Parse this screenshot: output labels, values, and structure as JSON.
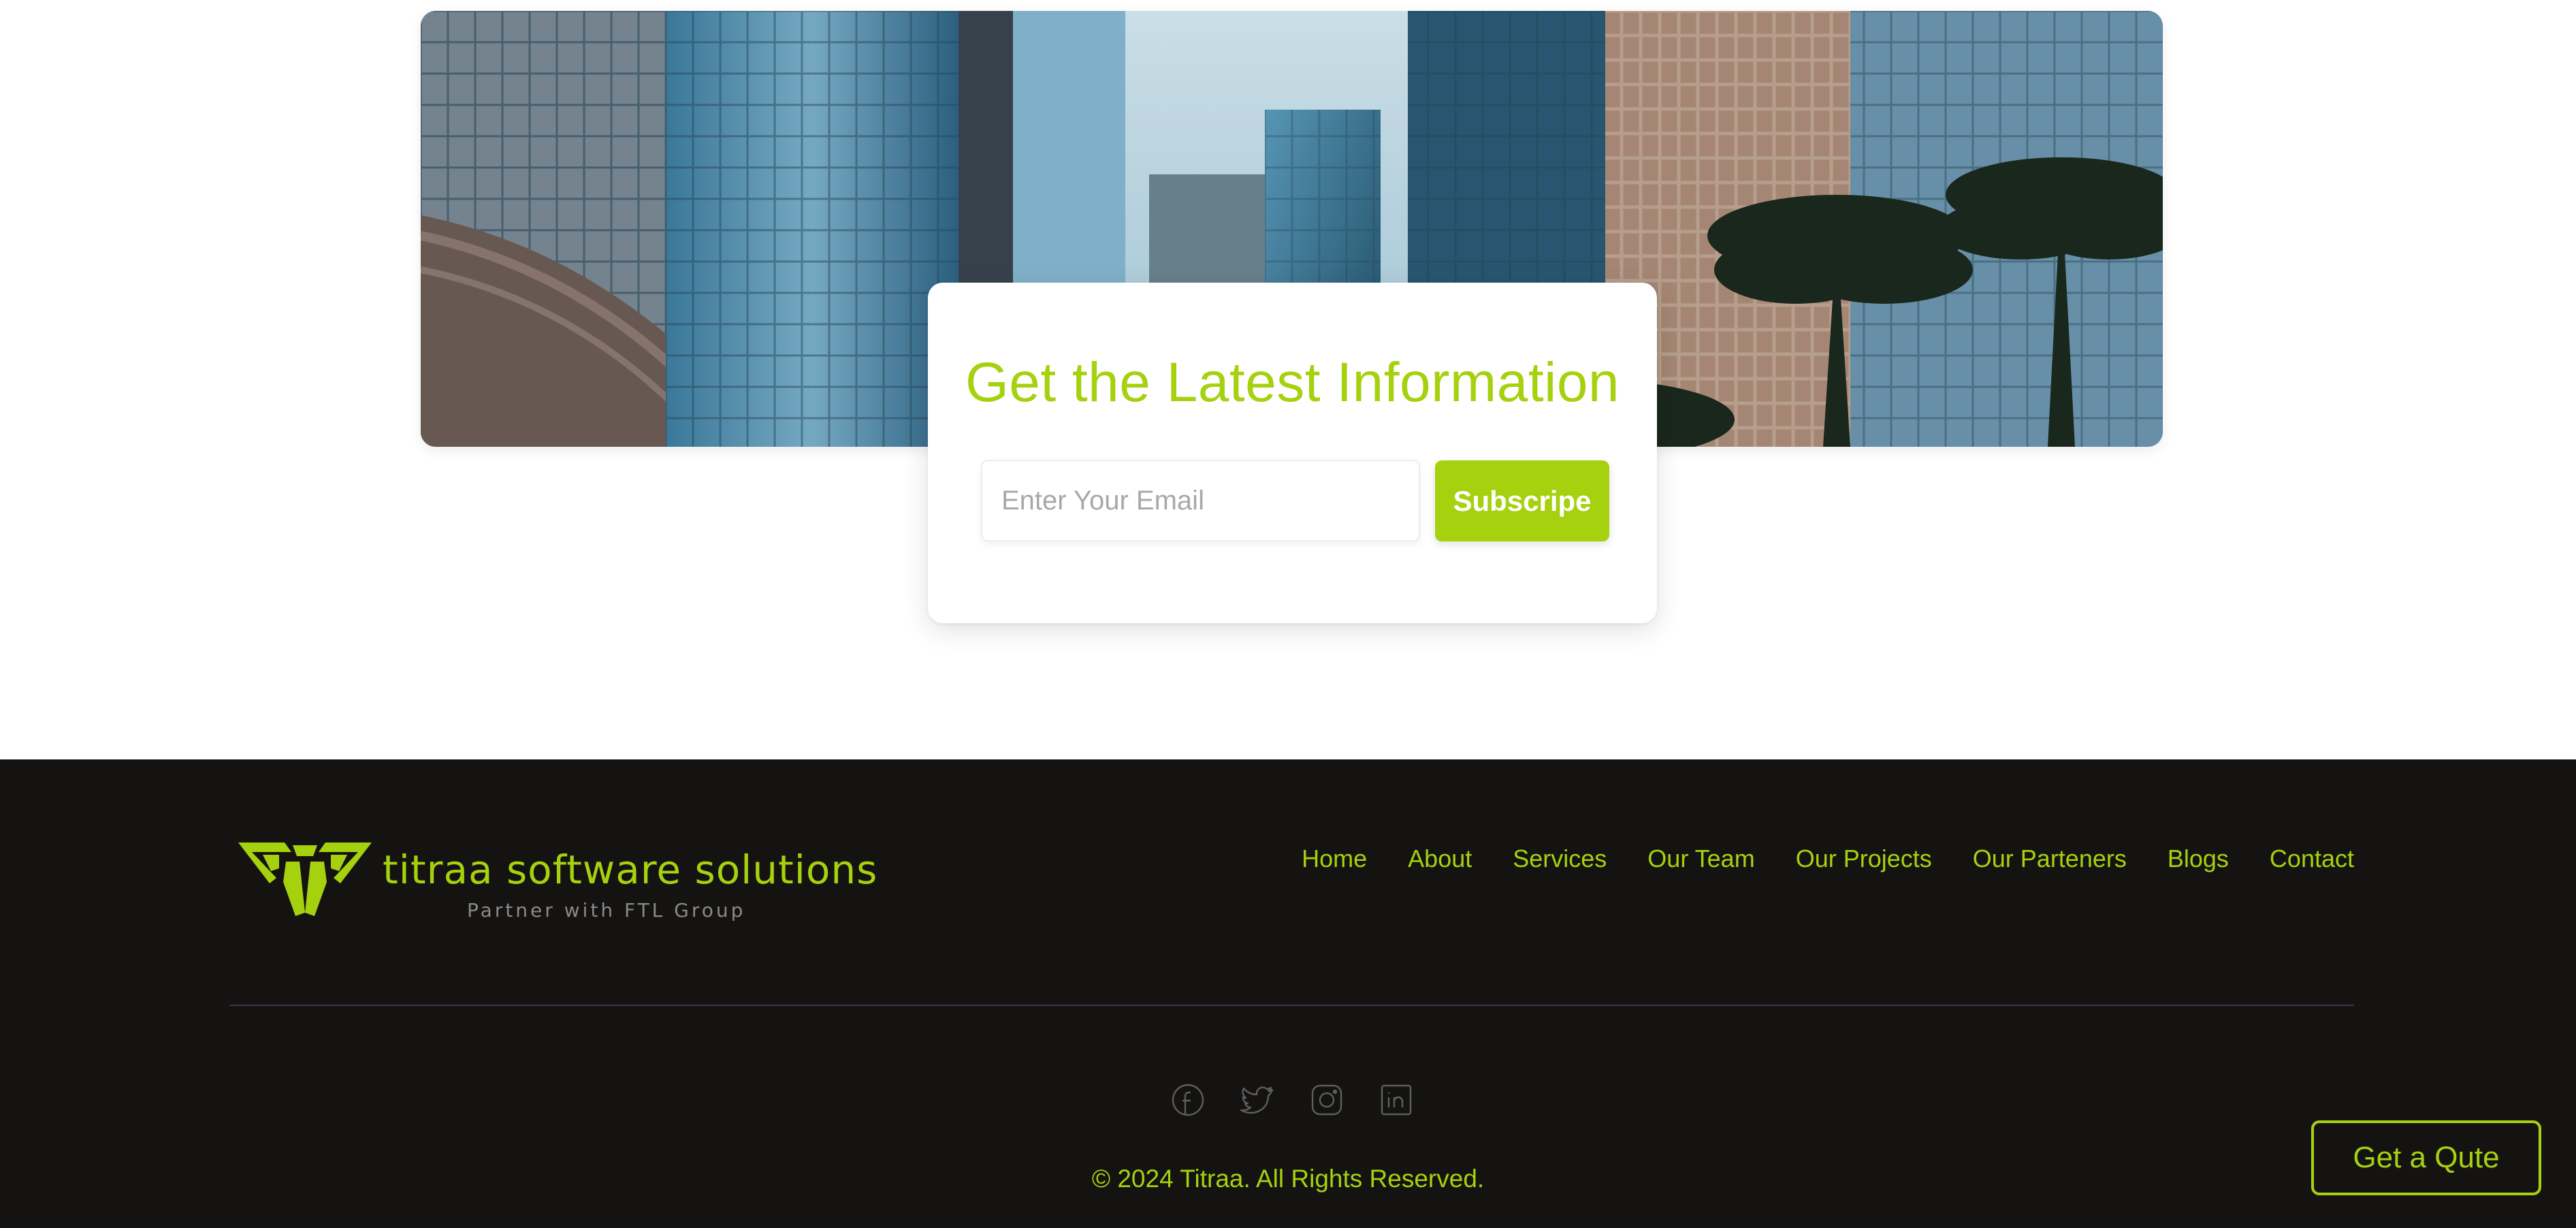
{
  "newsletter": {
    "title": "Get the Latest Information",
    "email_placeholder": "Enter Your Email",
    "subscribe_label": "Subscripe"
  },
  "footer": {
    "logo": {
      "name": "titraa software solutions",
      "tagline": "Partner with FTL Group"
    },
    "nav": [
      {
        "label": "Home"
      },
      {
        "label": "About"
      },
      {
        "label": "Services"
      },
      {
        "label": "Our Team"
      },
      {
        "label": "Our Projects"
      },
      {
        "label": "Our Parteners"
      },
      {
        "label": "Blogs"
      },
      {
        "label": "Contact"
      }
    ],
    "social_icons": [
      "facebook-icon",
      "twitter-icon",
      "instagram-icon",
      "linkedin-icon"
    ],
    "copyright": "© 2024 Titraa. All Rights Reserved."
  },
  "quote_button_label": "Get a Qute",
  "colors": {
    "accent": "#a6d10e",
    "footer_bg": "#141312",
    "divider": "#3a3748",
    "social_icon": "#5e5e5e"
  }
}
